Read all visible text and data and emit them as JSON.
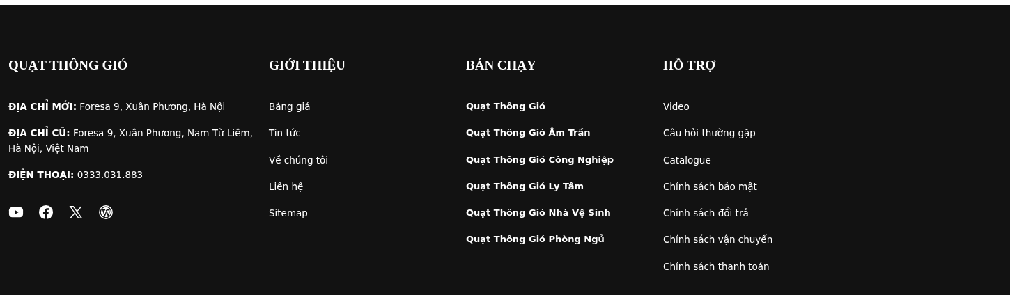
{
  "contact": {
    "heading": "QUẠT THÔNG GIÓ",
    "lines": [
      {
        "text": "**ĐỊA CHỈ MỚI:**  Foresa 9, Xuân Phương, Hà Nội"
      },
      {
        "text": "**ĐỊA CHỈ CŨ:**  Foresa 9, Xuân Phương, Nam Từ Liêm, Hà Nội, Việt Nam"
      },
      {
        "text": "**ĐIỆN THOẠI:** 0333.031.883"
      }
    ],
    "social": [
      {
        "kind": "youtube"
      },
      {
        "kind": "facebook"
      },
      {
        "kind": "x"
      },
      {
        "kind": "wordpress"
      }
    ]
  },
  "columns": [
    {
      "heading": "GIỚI THIỆU",
      "bold": false,
      "links": [
        "Bảng giá",
        "Tin tức",
        "Về chúng tôi",
        "Liên hệ",
        "Sitemap"
      ]
    },
    {
      "heading": "BÁN CHẠY",
      "bold": true,
      "links": [
        "Quạt Thông Gió",
        "Quạt Thông Gió Âm Trần",
        "Quạt Thông Gió Công Nghiệp",
        "Quạt Thông Gió Ly Tâm",
        "Quạt Thông Gió Nhà Vệ Sinh",
        "Quạt Thông Gió Phòng Ngủ"
      ]
    },
    {
      "heading": "HỖ TRỢ",
      "bold": false,
      "links": [
        "Video",
        "Câu hỏi thường gặp",
        "Catalogue",
        "Chính sách bảo mật",
        "Chính sách đổi trả",
        "Chính sách vận chuyển",
        "Chính sách thanh toán"
      ]
    }
  ]
}
